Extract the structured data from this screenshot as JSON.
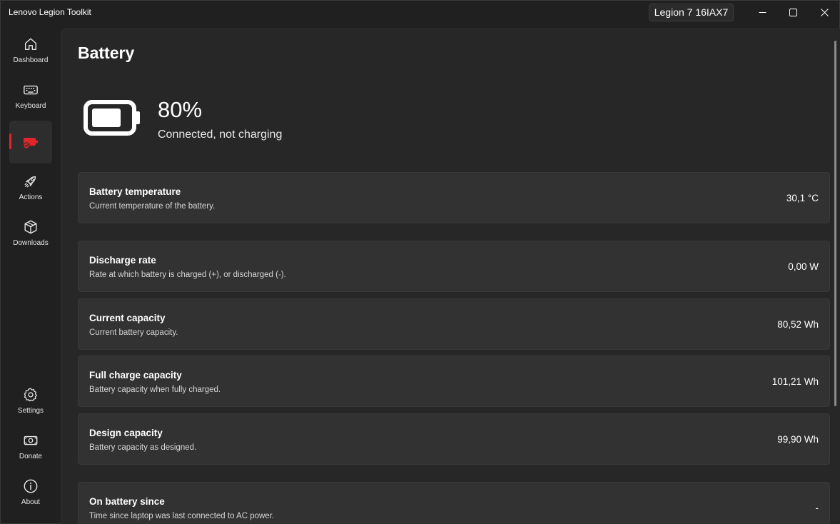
{
  "app": {
    "title": "Lenovo Legion Toolkit",
    "device_model": "Legion 7 16IAX7"
  },
  "window_controls": {
    "minimize_icon": "minimize-icon",
    "maximize_icon": "maximize-icon",
    "close_icon": "close-icon"
  },
  "sidebar": {
    "items": [
      {
        "label": "Dashboard",
        "icon": "home-icon"
      },
      {
        "label": "Keyboard",
        "icon": "keyboard-icon"
      },
      {
        "label": "",
        "icon": "battery-check-icon",
        "active": true
      },
      {
        "label": "Actions",
        "icon": "rocket-icon"
      },
      {
        "label": "Downloads",
        "icon": "box-icon"
      }
    ],
    "bottom_items": [
      {
        "label": "Settings",
        "icon": "gear-icon"
      },
      {
        "label": "Donate",
        "icon": "money-icon"
      },
      {
        "label": "About",
        "icon": "info-icon"
      }
    ],
    "accent_color": "#e1262b"
  },
  "page": {
    "title": "Battery",
    "battery_percent": "80%",
    "battery_level": 0.8,
    "status": "Connected, not charging"
  },
  "cards": [
    {
      "title": "Battery temperature",
      "description": "Current temperature of the battery.",
      "value": "30,1 °C"
    },
    {
      "title": "Discharge rate",
      "description": "Rate at which battery is charged (+), or discharged (-).",
      "value": "0,00 W"
    },
    {
      "title": "Current capacity",
      "description": "Current battery capacity.",
      "value": "80,52 Wh"
    },
    {
      "title": "Full charge capacity",
      "description": "Battery capacity when fully charged.",
      "value": "101,21 Wh"
    },
    {
      "title": "Design capacity",
      "description": "Battery capacity as designed.",
      "value": "99,90 Wh"
    },
    {
      "title": "On battery since",
      "description": "Time since laptop was last connected to AC power.",
      "value": "-"
    }
  ]
}
